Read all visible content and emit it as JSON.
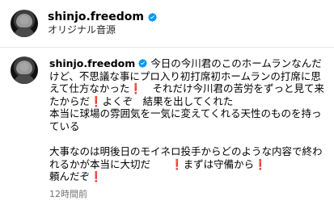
{
  "post": {
    "username": "shinjo.freedom",
    "subtitle": "オリジナル音源",
    "verified_icon": "verified-badge-icon"
  },
  "comment": {
    "username": "shinjo.freedom",
    "lines": [
      "今日の今川君のこのホームランなんだけど、不思議な事にプロ入り初打席初ホームランの打席に思えて仕方なかった❗️　それだけ今川君の苦労をずっと見て来たからだ❗️よくぞ　結果を出してくれた",
      "本当に球場の雰囲気を一気に変えてくれる天性のものを持っている",
      "",
      "大事なのは明後日のモイネロ投手からどのような内容で終われるかが本当に大切だ　　❗️まずは守備から❗️",
      "頼んだぞ❗️"
    ],
    "timestamp": "12時間前",
    "verified_icon": "verified-badge-icon"
  }
}
